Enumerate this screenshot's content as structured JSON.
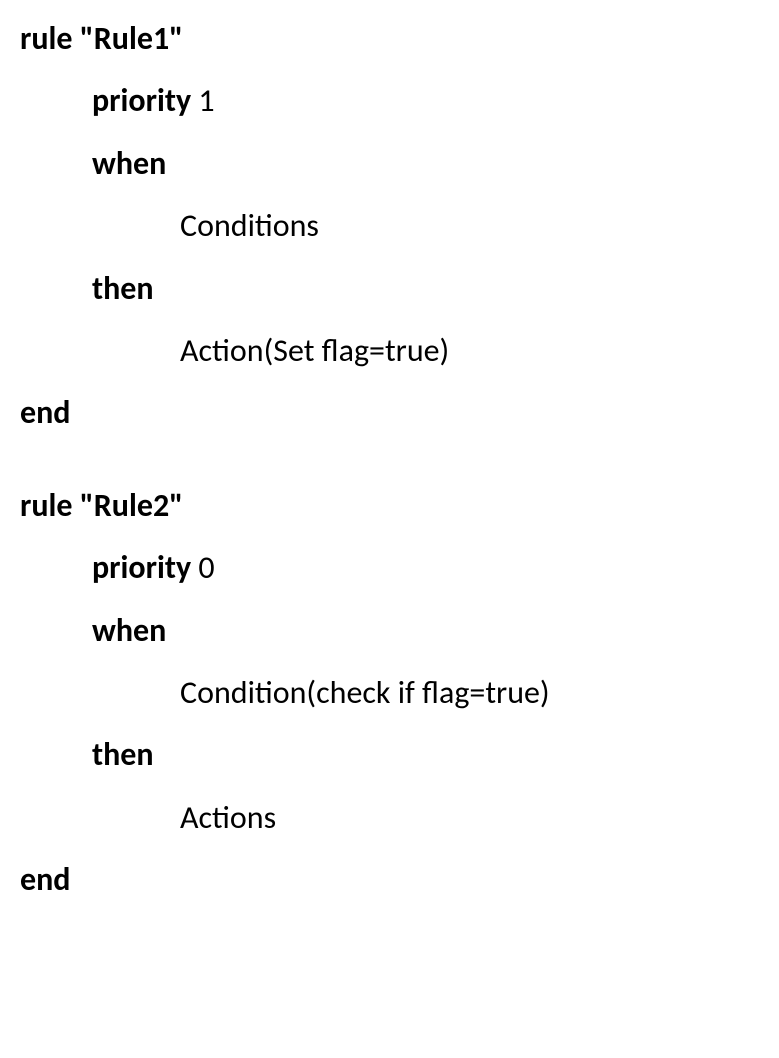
{
  "rules": [
    {
      "keyword_rule": "rule",
      "name": "\"Rule1\"",
      "priority_keyword": "priority",
      "priority_value": "1",
      "when_keyword": "when",
      "condition_text": "Conditions",
      "then_keyword": "then",
      "action_text": "Action(Set flag=true)",
      "end_keyword": "end"
    },
    {
      "keyword_rule": "rule",
      "name": "\"Rule2\"",
      "priority_keyword": "priority",
      "priority_value": "0",
      "when_keyword": "when",
      "condition_text": "Condition(check if flag=true)",
      "then_keyword": "then",
      "action_text": "Actions",
      "end_keyword": "end"
    }
  ]
}
